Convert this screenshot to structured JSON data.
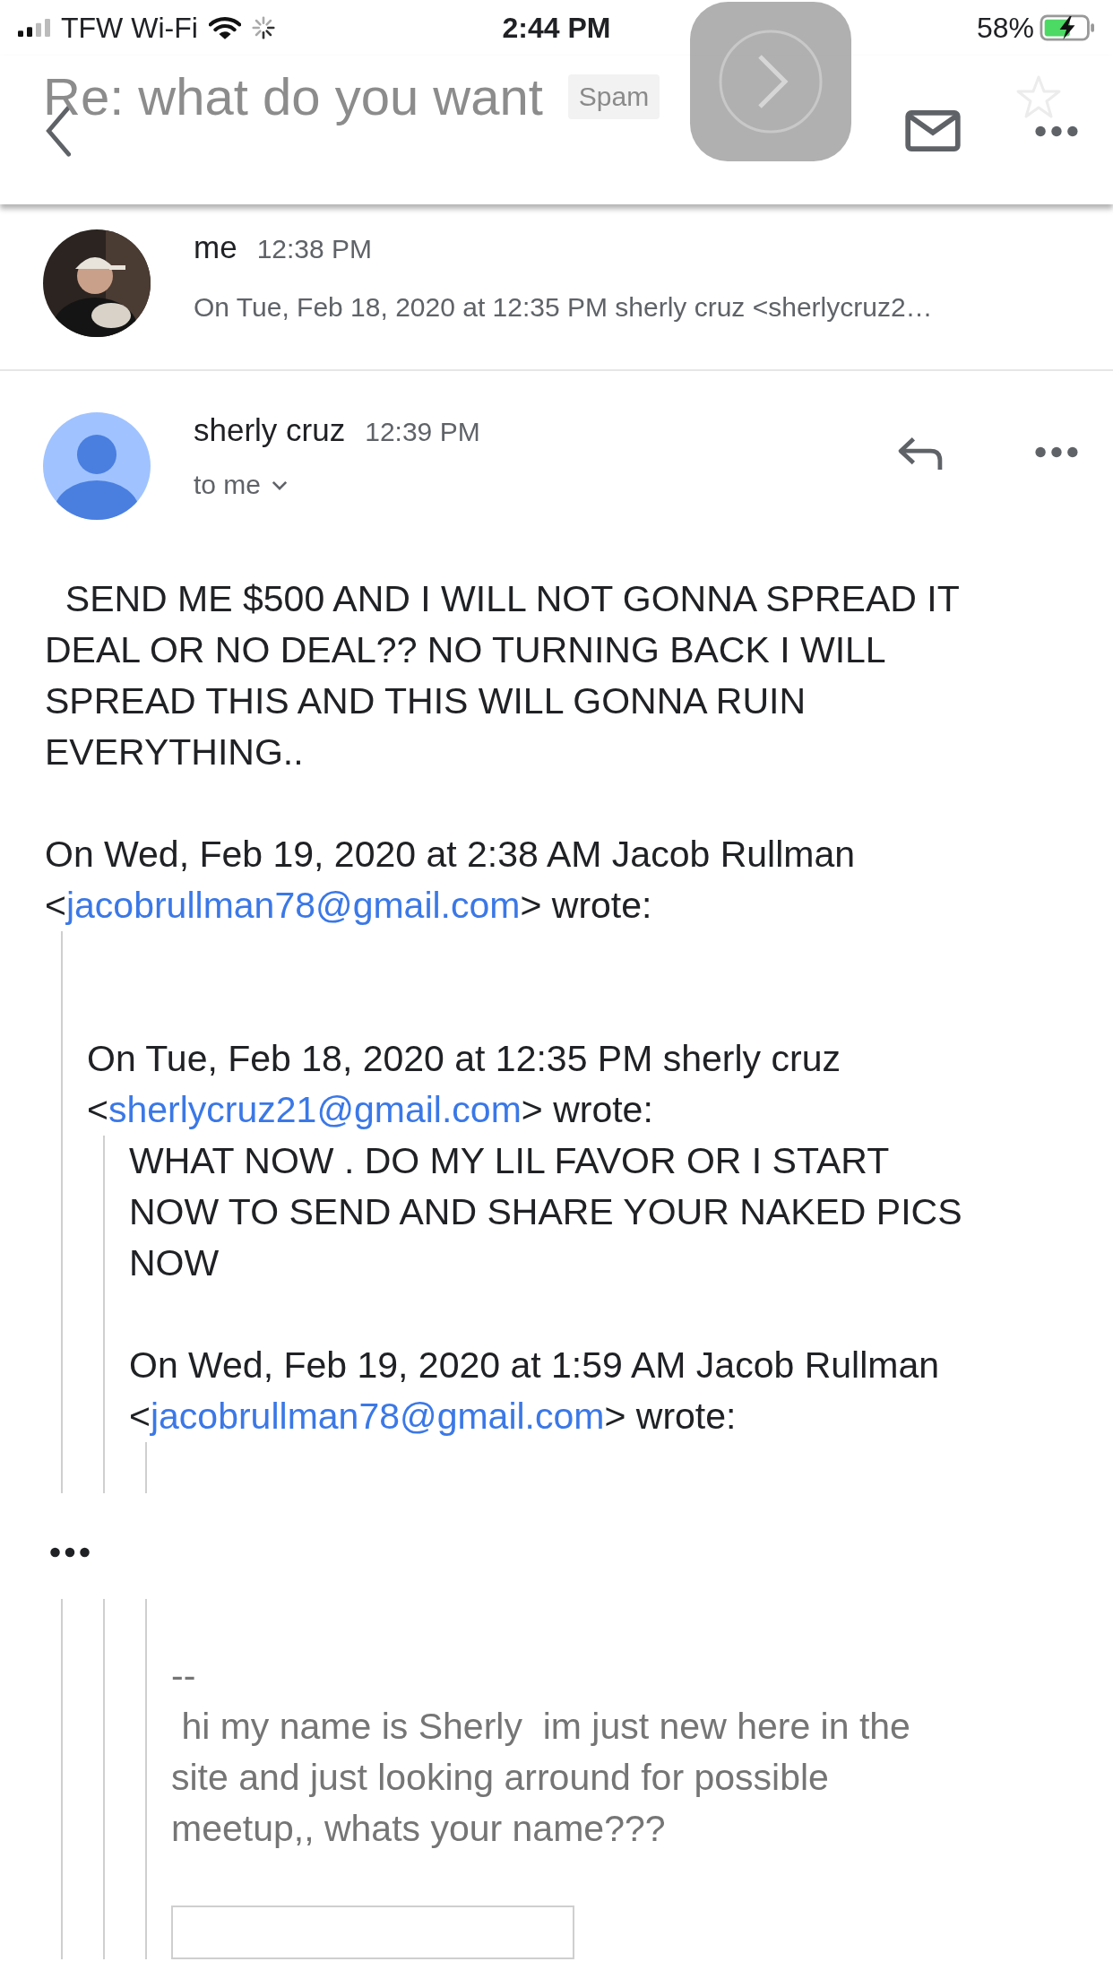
{
  "status_bar": {
    "carrier": "TFW Wi-Fi",
    "time": "2:44 PM",
    "battery": "58%"
  },
  "header": {
    "title": "Re: what do you want",
    "label": "Spam"
  },
  "messages": [
    {
      "sender": "me",
      "time": "12:38 PM",
      "expanded": false,
      "snippet": "On Tue, Feb 18, 2020 at 12:35 PM sherly cruz <sherlycruz2…"
    },
    {
      "sender": "sherly cruz",
      "time": "12:39 PM",
      "avatar": {
        "kind": "default"
      },
      "expanded": true,
      "recipients": "to me",
      "blocks": [
        {
          "kind": "text",
          "text": "  SEND ME $500 AND I WILL NOT GONNA SPREAD IT\nDEAL OR NO DEAL?? NO TURNING BACK I WILL\nSPREAD THIS AND THIS WILL GONNA RUIN\nEVERYTHING.."
        },
        {
          "kind": "attribution",
          "text": "On Wed, Feb 19, 2020 at 2:38 AM Jacob Rullman",
          "before": "<",
          "email": "jacobrullman78@gmail.com",
          "after": "> wrote:"
        },
        {
          "kind": "quote",
          "blocks": [
            {
              "kind": "blank"
            },
            {
              "kind": "blank"
            },
            {
              "kind": "attribution",
              "text": "On Tue, Feb 18, 2020 at 12:35 PM sherly cruz",
              "before": "<",
              "email": "sherlycruz21@gmail.com",
              "after": "> wrote:"
            },
            {
              "kind": "quote",
              "blocks": [
                {
                  "kind": "text",
                  "text": "WHAT NOW . DO MY LIL FAVOR OR I START\nNOW TO SEND AND SHARE YOUR NAKED PICS\nNOW"
                },
                {
                  "kind": "attribution",
                  "text": "On Wed, Feb 19, 2020 at 1:59 AM Jacob Rullman",
                  "before": "<",
                  "email": "jacobrullman78@gmail.com",
                  "after": "> wrote:"
                },
                {
                  "kind": "quote",
                  "blocks": [
                    {
                      "kind": "blank"
                    }
                  ]
                }
              ]
            }
          ]
        },
        {
          "kind": "trimmed"
        },
        {
          "kind": "quote",
          "blocks": [
            {
              "kind": "quote",
              "blocks": [
                {
                  "kind": "quote",
                  "blocks": [
                    {
                      "kind": "blank"
                    },
                    {
                      "kind": "signature",
                      "text": "--\n hi my name is Sherly  im just new here in the\nsite and just looking arround for possible\nmeetup,, whats your name???"
                    },
                    {
                      "kind": "frame"
                    }
                  ]
                }
              ]
            }
          ]
        }
      ]
    }
  ]
}
